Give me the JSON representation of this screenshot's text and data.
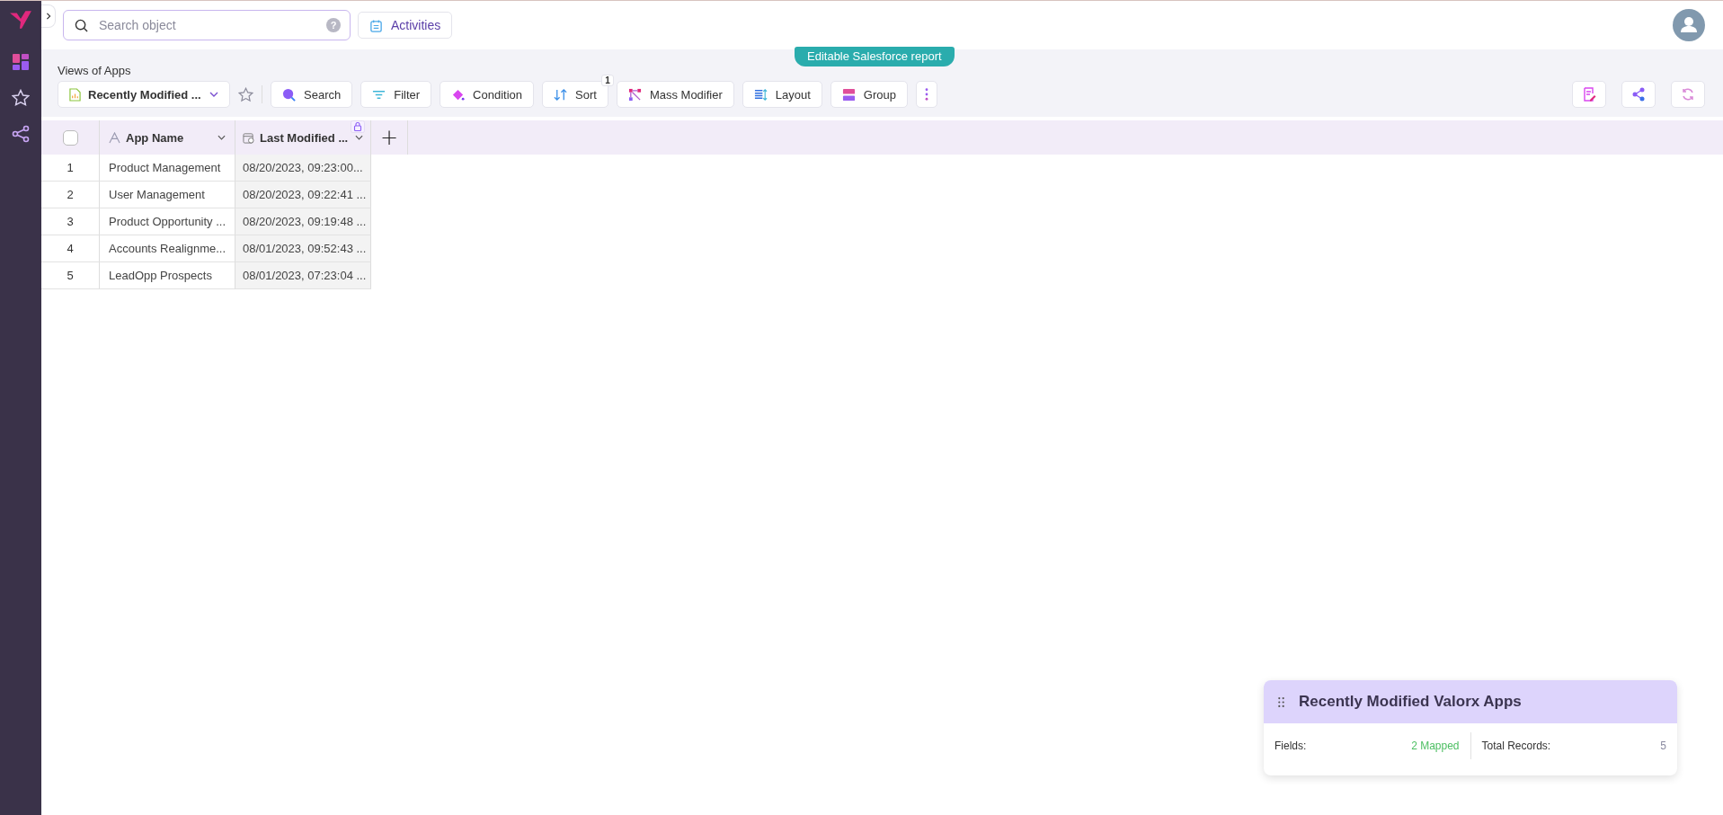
{
  "search": {
    "placeholder": "Search object",
    "help": "?"
  },
  "activities_button": {
    "label": "Activities"
  },
  "banner": "Editable Salesforce report",
  "views": {
    "label": "Views of Apps",
    "selected_view": "Recently Modified ...",
    "favorite": false
  },
  "toolbar": [
    {
      "label": "Search"
    },
    {
      "label": "Filter"
    },
    {
      "label": "Condition"
    },
    {
      "label": "Sort",
      "badge": "1"
    },
    {
      "label": "Mass Modifier"
    },
    {
      "label": "Layout"
    },
    {
      "label": "Group"
    }
  ],
  "table": {
    "select_all_checked": false,
    "add_column": "+",
    "columns": [
      {
        "label": "App Name",
        "locked": false
      },
      {
        "label": "Last Modified ...",
        "locked": true
      }
    ],
    "rows": [
      {
        "number": "1",
        "cells": [
          "Product Management",
          "08/20/2023, 09:23:00..."
        ]
      },
      {
        "number": "2",
        "cells": [
          "User Management",
          "08/20/2023, 09:22:41 ..."
        ]
      },
      {
        "number": "3",
        "cells": [
          "Product Opportunity ...",
          "08/20/2023, 09:19:48 ..."
        ]
      },
      {
        "number": "4",
        "cells": [
          "Accounts Realignme...",
          "08/01/2023, 09:52:43 ..."
        ]
      },
      {
        "number": "5",
        "cells": [
          "LeadOpp Prospects",
          "08/01/2023, 07:23:04 ..."
        ]
      }
    ]
  },
  "summary_card": {
    "title": "Recently Modified Valorx Apps",
    "fields_label": "Fields:",
    "fields_value": "2 Mapped",
    "records_label": "Total Records:",
    "records_value": "5"
  }
}
